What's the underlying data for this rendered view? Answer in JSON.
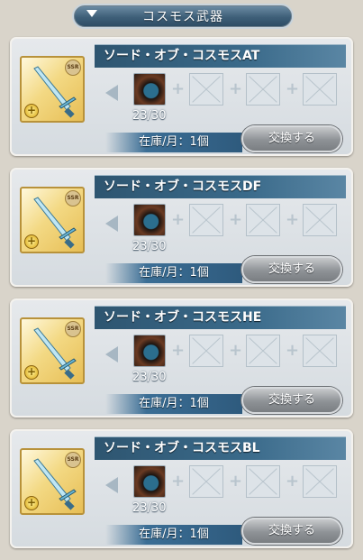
{
  "header": {
    "title": "コスモス武器"
  },
  "cards": [
    {
      "name": "ソード・オブ・コスモスAT",
      "count": "23/30",
      "stock": "在庫/月：1個",
      "button": "交換する"
    },
    {
      "name": "ソード・オブ・コスモスDF",
      "count": "23/30",
      "stock": "在庫/月：1個",
      "button": "交換する"
    },
    {
      "name": "ソード・オブ・コスモスHE",
      "count": "23/30",
      "stock": "在庫/月：1個",
      "button": "交換する"
    },
    {
      "name": "ソード・オブ・コスモスBL",
      "count": "23/30",
      "stock": "在庫/月：1個",
      "button": "交換する"
    }
  ],
  "badge_text": "SSR",
  "colors": {
    "name_bar": "#2e5570",
    "icon_frame": "#b8923a"
  }
}
